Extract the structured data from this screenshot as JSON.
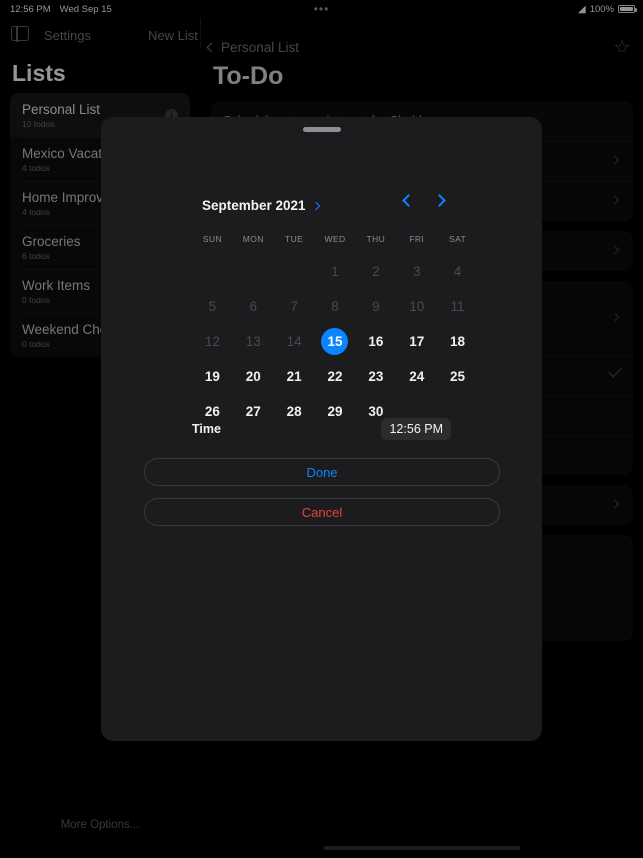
{
  "status_bar": {
    "time": "12:56 PM",
    "date": "Wed Sep 15",
    "multitask_icon": "more-dots-icon",
    "wifi_icon": "wifi-icon",
    "battery_percent": "100%",
    "battery_icon": "battery-full-icon"
  },
  "top_nav": {
    "sidebar_toggle_icon": "sidebar-toggle-icon",
    "settings_label": "Settings",
    "new_list_label": "New List",
    "back_chevron_icon": "chevron-left-icon",
    "back_label": "Personal List",
    "favorite_icon": "star-outline-icon"
  },
  "sidebar": {
    "title": "Lists",
    "more_options_label": "More Options...",
    "items": [
      {
        "name": "Personal List",
        "count": "10 todos",
        "selected": true,
        "info_icon": "info-icon"
      },
      {
        "name": "Mexico Vacation",
        "count": "4 todos",
        "selected": false
      },
      {
        "name": "Home Improvement",
        "count": "4 todos",
        "selected": false
      },
      {
        "name": "Groceries",
        "count": "6 todos",
        "selected": false
      },
      {
        "name": "Work Items",
        "count": "0 todos",
        "selected": false
      },
      {
        "name": "Weekend Chores",
        "count": "0 todos",
        "selected": false
      }
    ]
  },
  "detail": {
    "title": "To-Do",
    "first_item": "Schedule vet appointment for Chubbs",
    "chevron_icon": "chevron-right-icon",
    "check_icon": "checkmark-icon"
  },
  "modal": {
    "grabber_icon": "drag-handle-icon",
    "month_label": "September 2021",
    "month_chevron_icon": "chevron-right-icon",
    "prev_icon": "chevron-left-icon",
    "next_icon": "chevron-right-icon",
    "weekdays": [
      "SUN",
      "MON",
      "TUE",
      "WED",
      "THU",
      "FRI",
      "SAT"
    ],
    "leading_blanks": 3,
    "days": [
      {
        "n": "1",
        "state": "dim"
      },
      {
        "n": "2",
        "state": "dim"
      },
      {
        "n": "3",
        "state": "dim"
      },
      {
        "n": "4",
        "state": "dim"
      },
      {
        "n": "5",
        "state": "dim"
      },
      {
        "n": "6",
        "state": "dim"
      },
      {
        "n": "7",
        "state": "dim"
      },
      {
        "n": "8",
        "state": "dim"
      },
      {
        "n": "9",
        "state": "dim"
      },
      {
        "n": "10",
        "state": "dim"
      },
      {
        "n": "11",
        "state": "dim"
      },
      {
        "n": "12",
        "state": "dim"
      },
      {
        "n": "13",
        "state": "dim"
      },
      {
        "n": "14",
        "state": "dim"
      },
      {
        "n": "15",
        "state": "selected"
      },
      {
        "n": "16",
        "state": "normal"
      },
      {
        "n": "17",
        "state": "normal"
      },
      {
        "n": "18",
        "state": "normal"
      },
      {
        "n": "19",
        "state": "normal"
      },
      {
        "n": "20",
        "state": "normal"
      },
      {
        "n": "21",
        "state": "normal"
      },
      {
        "n": "22",
        "state": "normal"
      },
      {
        "n": "23",
        "state": "normal"
      },
      {
        "n": "24",
        "state": "normal"
      },
      {
        "n": "25",
        "state": "normal"
      },
      {
        "n": "26",
        "state": "normal"
      },
      {
        "n": "27",
        "state": "normal"
      },
      {
        "n": "28",
        "state": "normal"
      },
      {
        "n": "29",
        "state": "normal"
      },
      {
        "n": "30",
        "state": "normal"
      }
    ],
    "time_label": "Time",
    "time_value": "12:56 PM",
    "done_label": "Done",
    "cancel_label": "Cancel"
  },
  "colors": {
    "accent_blue": "#0a84ff",
    "destructive_red": "#e2433d",
    "sheet_bg": "#1c1c1e",
    "page_bg": "#000000"
  }
}
